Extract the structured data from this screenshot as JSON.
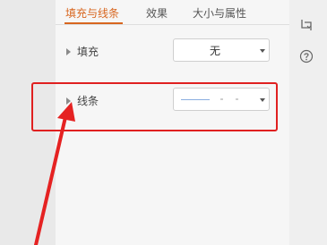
{
  "tabs": [
    {
      "label": "填充与线条",
      "active": true
    },
    {
      "label": "效果",
      "active": false
    },
    {
      "label": "大小与属性",
      "active": false
    }
  ],
  "fill": {
    "label": "填充",
    "value": "无"
  },
  "line": {
    "label": "线条",
    "value_style": "solid-line-preview"
  },
  "colors": {
    "accent": "#d8661f",
    "highlight": "#e02020",
    "arrow": "#e52222"
  },
  "side_icons": [
    "crop-rotate-icon",
    "help-icon"
  ]
}
